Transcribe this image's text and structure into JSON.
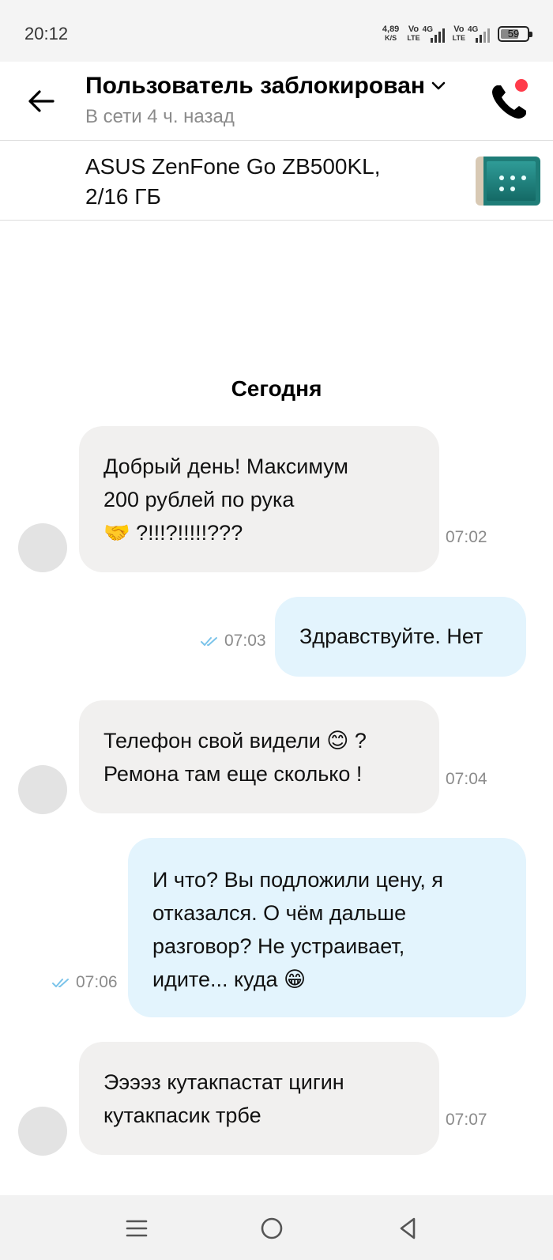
{
  "status_bar": {
    "time": "20:12",
    "net_speed_value": "4,89",
    "net_speed_unit": "K/S",
    "sim1_label_top": "Vo",
    "sim1_label_bottom": "LTE",
    "sim1_net": "4G",
    "sim2_label_top": "Vo",
    "sim2_label_bottom": "LTE",
    "sim2_net": "4G",
    "battery": "59"
  },
  "header": {
    "title": "Пользователь заблокирован",
    "subtitle": "В сети 4 ч. назад",
    "back_icon": "arrow-left-icon",
    "dropdown_icon": "chevron-down-icon",
    "call_icon": "phone-icon",
    "notification_color": "#ff3b4a"
  },
  "product": {
    "title_line1": "ASUS ZenFone Go ZB500KL,",
    "title_line2": "2/16 ГБ"
  },
  "chat": {
    "date": "Сегодня",
    "messages": [
      {
        "direction": "in",
        "lines": [
          "Добрый день! Максимум",
          "200 рублей по рука",
          "🤝 ?!!!?!!!!!???"
        ],
        "time": "07:02"
      },
      {
        "direction": "out",
        "lines": [
          "Здравствуйте. Нет"
        ],
        "time": "07:03",
        "read": true
      },
      {
        "direction": "in",
        "lines": [
          "Телефон свой видели 😊 ?",
          "Ремона там еще сколько !"
        ],
        "time": "07:04"
      },
      {
        "direction": "out",
        "lines": [
          "И что? Вы подложили цену, я",
          "отказался. О чём дальше",
          "разговор? Не устраивает,",
          "идите... куда 😁"
        ],
        "time": "07:06",
        "read": true
      },
      {
        "direction": "in",
        "lines": [
          "Ээээз кутакпастат цигин",
          "кутакпасик трбе"
        ],
        "time": "07:07"
      }
    ]
  },
  "colors": {
    "incoming_bubble": "#f1f0ef",
    "outgoing_bubble": "#e3f4fd",
    "read_ticks": "#7cc4ea"
  },
  "navbar": {
    "menu_icon": "menu-icon",
    "home_icon": "home-circle-icon",
    "back_icon": "back-triangle-icon"
  }
}
